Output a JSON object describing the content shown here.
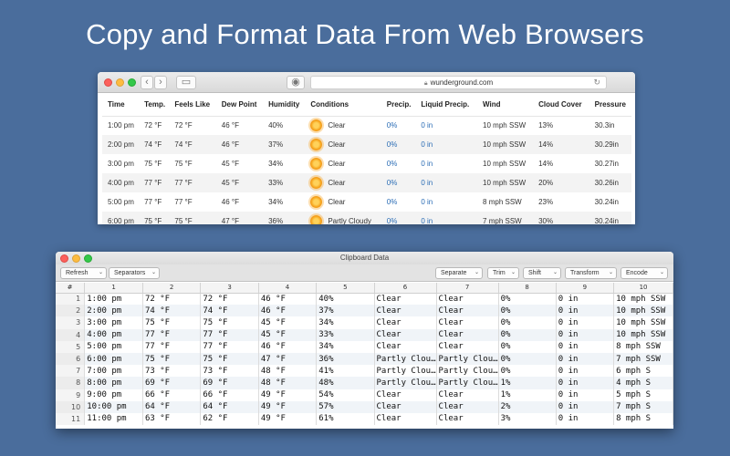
{
  "headline": "Copy and Format Data From Web Browsers",
  "browser": {
    "url": "wunderground.com",
    "headers": [
      "Time",
      "Temp.",
      "Feels Like",
      "Dew Point",
      "Humidity",
      "Conditions",
      "Precip.",
      "Liquid Precip.",
      "Wind",
      "Cloud Cover",
      "Pressure"
    ],
    "rows": [
      [
        "1:00 pm",
        "72 °F",
        "72 °F",
        "46 °F",
        "40%",
        "Clear",
        "0%",
        "0 in",
        "10 mph SSW",
        "13%",
        "30.3in"
      ],
      [
        "2:00 pm",
        "74 °F",
        "74 °F",
        "46 °F",
        "37%",
        "Clear",
        "0%",
        "0 in",
        "10 mph SSW",
        "14%",
        "30.29in"
      ],
      [
        "3:00 pm",
        "75 °F",
        "75 °F",
        "45 °F",
        "34%",
        "Clear",
        "0%",
        "0 in",
        "10 mph SSW",
        "14%",
        "30.27in"
      ],
      [
        "4:00 pm",
        "77 °F",
        "77 °F",
        "45 °F",
        "33%",
        "Clear",
        "0%",
        "0 in",
        "10 mph SSW",
        "20%",
        "30.26in"
      ],
      [
        "5:00 pm",
        "77 °F",
        "77 °F",
        "46 °F",
        "34%",
        "Clear",
        "0%",
        "0 in",
        "8 mph SSW",
        "23%",
        "30.24in"
      ],
      [
        "6:00 pm",
        "75 °F",
        "75 °F",
        "47 °F",
        "36%",
        "Partly Cloudy",
        "0%",
        "0 in",
        "7 mph SSW",
        "30%",
        "30.24in"
      ]
    ]
  },
  "clipboard": {
    "title": "Clipboard Data",
    "toolbar": {
      "refresh": "Refresh",
      "separators": "Separators",
      "separate": "Separate",
      "trim": "Trim",
      "shift": "Shift",
      "transform": "Transform",
      "encode": "Encode"
    },
    "columns": [
      "#",
      "1",
      "2",
      "3",
      "4",
      "5",
      "6",
      "7",
      "8",
      "9",
      "10"
    ],
    "rows": [
      [
        "1",
        "1:00 pm",
        "72 °F",
        "72 °F",
        "46 °F",
        "40%",
        "Clear",
        "Clear",
        "0%",
        "0 in",
        "10 mph SSW"
      ],
      [
        "2",
        "2:00 pm",
        "74 °F",
        "74 °F",
        "46 °F",
        "37%",
        "Clear",
        "Clear",
        "0%",
        "0 in",
        "10 mph SSW"
      ],
      [
        "3",
        "3:00 pm",
        "75 °F",
        "75 °F",
        "45 °F",
        "34%",
        "Clear",
        "Clear",
        "0%",
        "0 in",
        "10 mph SSW"
      ],
      [
        "4",
        "4:00 pm",
        "77 °F",
        "77 °F",
        "45 °F",
        "33%",
        "Clear",
        "Clear",
        "0%",
        "0 in",
        "10 mph SSW"
      ],
      [
        "5",
        "5:00 pm",
        "77 °F",
        "77 °F",
        "46 °F",
        "34%",
        "Clear",
        "Clear",
        "0%",
        "0 in",
        "8 mph SSW"
      ],
      [
        "6",
        "6:00 pm",
        "75 °F",
        "75 °F",
        "47 °F",
        "36%",
        "Partly Clou…",
        "Partly Clou…",
        "0%",
        "0 in",
        "7 mph SSW"
      ],
      [
        "7",
        "7:00 pm",
        "73 °F",
        "73 °F",
        "48 °F",
        "41%",
        "Partly Clou…",
        "Partly Clou…",
        "0%",
        "0 in",
        "6 mph S"
      ],
      [
        "8",
        "8:00 pm",
        "69 °F",
        "69 °F",
        "48 °F",
        "48%",
        "Partly Clou…",
        "Partly Clou…",
        "1%",
        "0 in",
        "4 mph S"
      ],
      [
        "9",
        "9:00 pm",
        "66 °F",
        "66 °F",
        "49 °F",
        "54%",
        "Clear",
        "Clear",
        "1%",
        "0 in",
        "5 mph S"
      ],
      [
        "10",
        "10:00 pm",
        "64 °F",
        "64 °F",
        "49 °F",
        "57%",
        "Clear",
        "Clear",
        "2%",
        "0 in",
        "7 mph S"
      ],
      [
        "11",
        "11:00 pm",
        "63 °F",
        "62 °F",
        "49 °F",
        "61%",
        "Clear",
        "Clear",
        "3%",
        "0 in",
        "8 mph S"
      ]
    ]
  }
}
